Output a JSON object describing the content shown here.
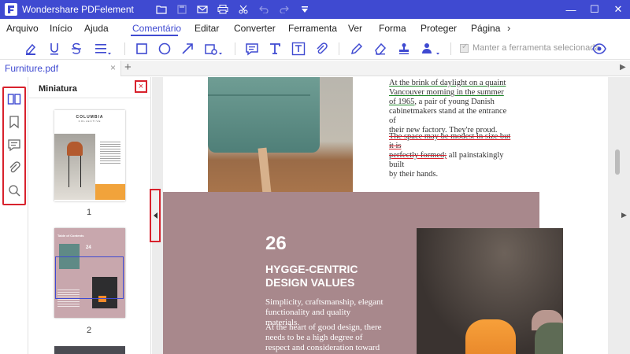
{
  "app": {
    "title": "Wondershare PDFelement"
  },
  "window_controls": {
    "minimize": "—",
    "maximize": "☐",
    "close": "✕"
  },
  "menu": {
    "items": [
      "Arquivo",
      "Início",
      "Ajuda",
      "Comentário",
      "Editar",
      "Converter",
      "Ferramenta",
      "Ver",
      "Forma",
      "Proteger",
      "Página"
    ],
    "active": "Comentário",
    "more": "›"
  },
  "toolbar": {
    "keep_tool_label": "Manter a ferramenta selecionada",
    "keep_tool_checked": true
  },
  "tabs": {
    "file_name": "Furniture.pdf",
    "close": "×",
    "add": "+",
    "scroll_right": "▶"
  },
  "thumbnails": {
    "header": "Miniatura",
    "close": "×",
    "pages": [
      {
        "number": "1",
        "brand": "COLUMBIA",
        "sub": "COLLECTIVE"
      },
      {
        "number": "2",
        "heading": "Table of Contents",
        "num": "24"
      }
    ]
  },
  "document": {
    "para1_parts": [
      "At the brink of daylight on a quaint",
      "Vancouver morning in the summer",
      "of 1965",
      ", a pair of young Danish",
      "cabinetmakers stand at the entrance of",
      "their new factory. They're proud."
    ],
    "para2_parts": [
      "The space may be modest in size but it is",
      "perfectly formed;",
      " all painstakingly built",
      "by their hands."
    ],
    "section_number": "26",
    "section_title": "HYGGE-CENTRIC DESIGN VALUES",
    "body1": "Simplicity, craftsmanship, elegant functionality and quality materials.",
    "body2": "At the heart of good design, there needs to be a high degree of respect and consideration toward the people being built for."
  },
  "colors": {
    "brand": "#3f4ad1",
    "highlight_box": "#d8222d",
    "underline": "#1f8a2a",
    "pink_panel": "#a8888c"
  }
}
